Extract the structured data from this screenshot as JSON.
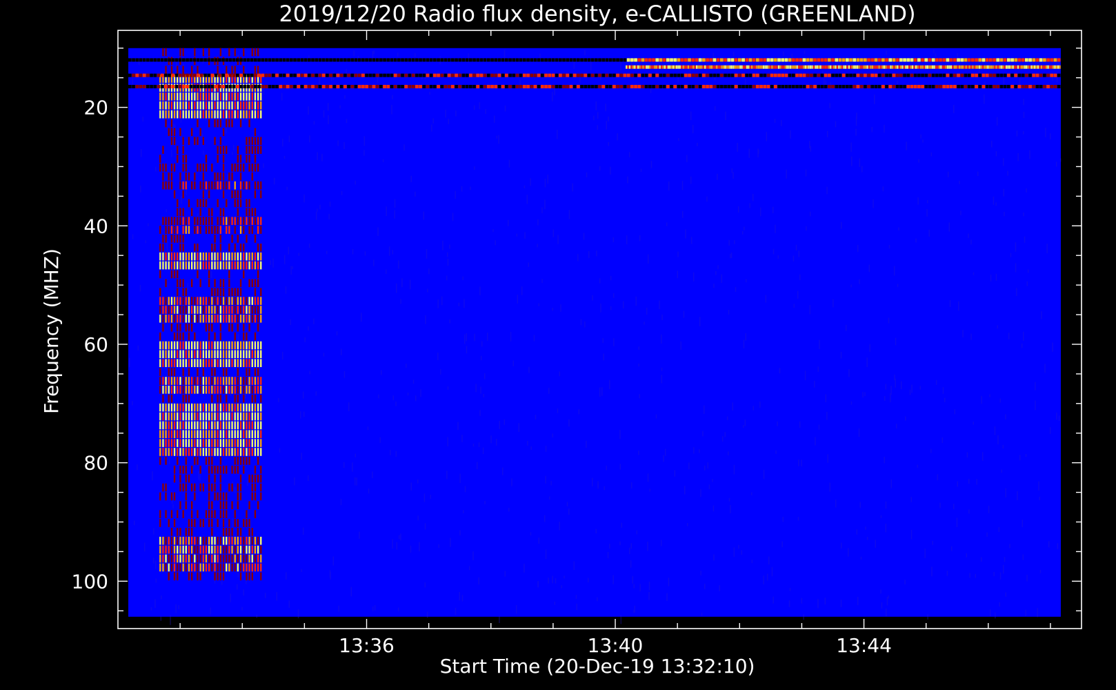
{
  "chart_data": {
    "type": "heatmap",
    "title": "2019/12/20  Radio flux density, e-CALLISTO (GREENLAND)",
    "xlabel": "Start Time (20-Dec-19 13:32:10)",
    "ylabel": "Frequency (MHZ)",
    "x_tick_labels": [
      "13:36",
      "13:40",
      "13:44"
    ],
    "x_tick_values_min": [
      816,
      820,
      824
    ],
    "y_tick_labels": [
      "20",
      "40",
      "60",
      "80",
      "100"
    ],
    "y_tick_values": [
      20,
      40,
      60,
      80,
      100
    ],
    "xlim_min": [
      812,
      827.5
    ],
    "ylim": [
      108,
      7
    ],
    "data_extent": {
      "time_start": "13:32:10",
      "time_end": "13:47:10",
      "freq_min_mhz": 10,
      "freq_max_mhz": 106
    },
    "colormap": [
      "#0000ff",
      "#8b0000",
      "#ff2a00",
      "#ffa500",
      "#ffff66"
    ],
    "background_color": "#0000ff",
    "features": [
      {
        "kind": "burst-block",
        "t_from": "13:32:40",
        "t_to": "13:34:20",
        "f_from": 10,
        "f_to": 100,
        "intensity": "medium"
      },
      {
        "kind": "rfi-band",
        "f": 12.0,
        "t_from": "13:32:10",
        "t_to": "13:47:10",
        "intensity": "high-after-13:40"
      },
      {
        "kind": "rfi-band",
        "f": 13.2,
        "t_from": "13:40:10",
        "t_to": "13:47:10",
        "intensity": "high"
      },
      {
        "kind": "rfi-band",
        "f": 14.6,
        "t_from": "13:32:10",
        "t_to": "13:47:10",
        "intensity": "medium"
      },
      {
        "kind": "rfi-band",
        "f": 16.5,
        "t_from": "13:32:10",
        "t_to": "13:47:10",
        "intensity": "medium"
      }
    ]
  }
}
